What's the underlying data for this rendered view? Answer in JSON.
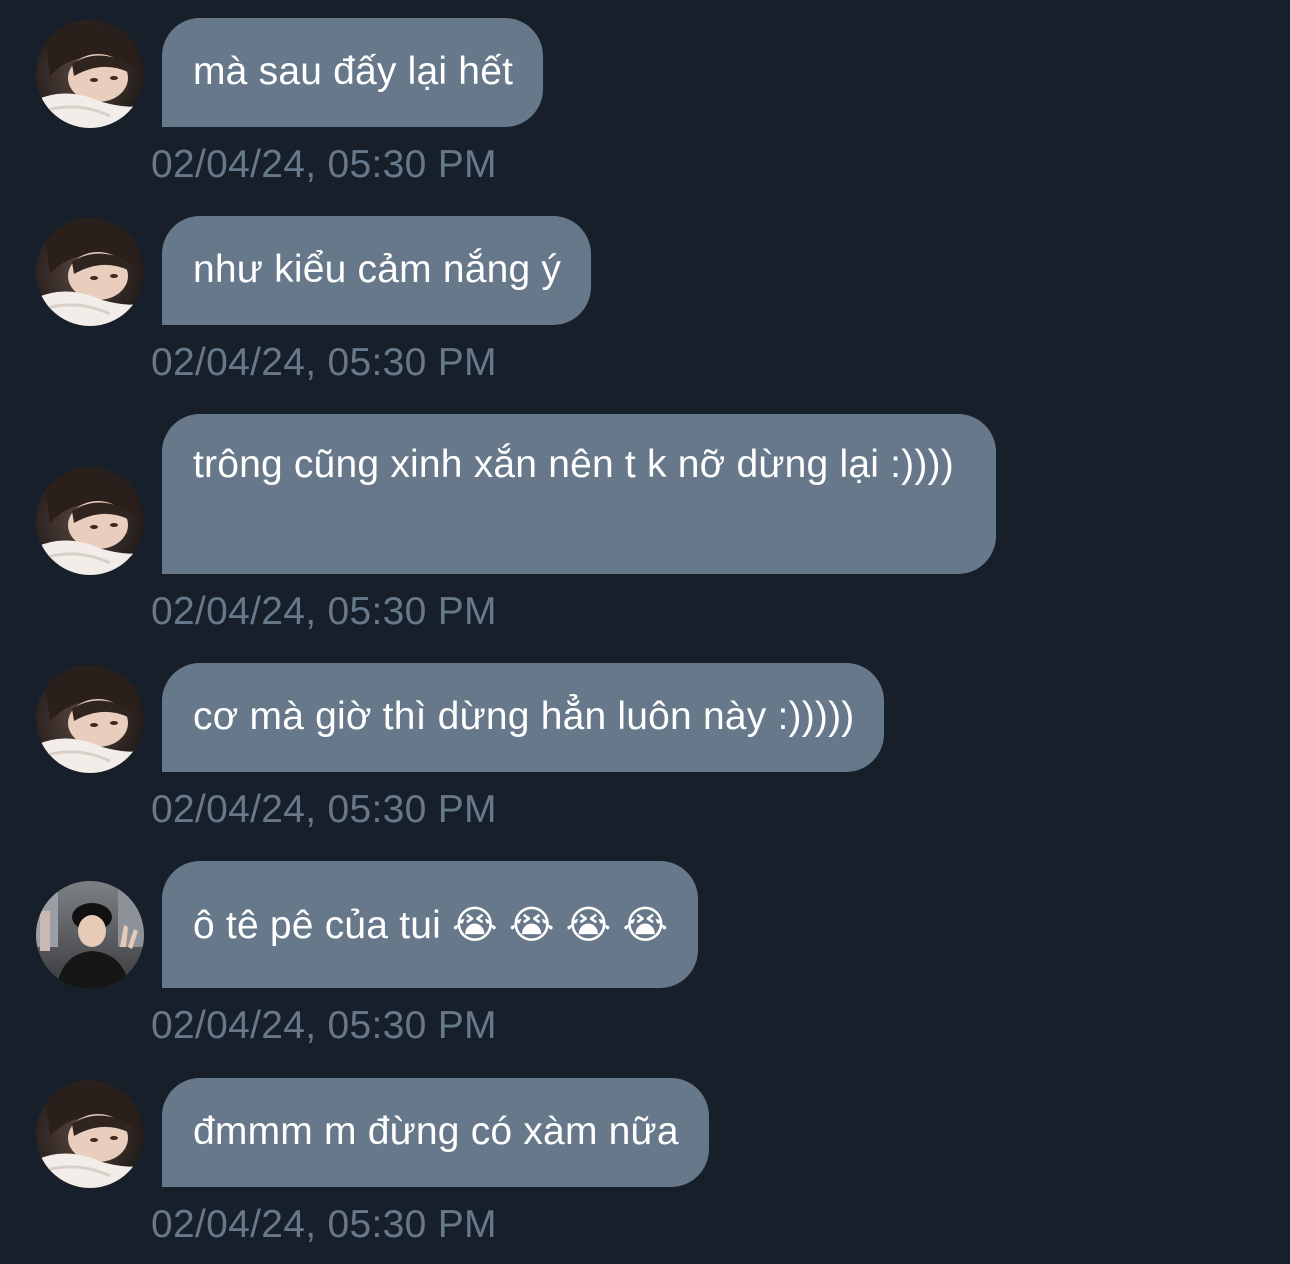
{
  "messages": [
    {
      "sender": "a",
      "text": "mà sau đấy lại hết",
      "time": "02/04/24, 05:30 PM"
    },
    {
      "sender": "a",
      "text": "như kiểu cảm nắng ý",
      "time": "02/04/24, 05:30 PM"
    },
    {
      "sender": "a",
      "text": "trông cũng xinh xắn nên t k nỡ dừng lại :))))",
      "time": "02/04/24, 05:30 PM"
    },
    {
      "sender": "a",
      "text": "cơ mà giờ thì dừng hẳn luôn này :)))))",
      "time": "02/04/24, 05:30 PM"
    },
    {
      "sender": "b",
      "text": "ô tê pê của tui 😭 😭 😭 😭",
      "time": "02/04/24, 05:30 PM"
    },
    {
      "sender": "a",
      "text": "đmmm m đừng có xàm nữa",
      "time": "02/04/24, 05:30 PM"
    }
  ],
  "colors": {
    "background": "#17202a",
    "bubble": "#66788a",
    "bubble_text": "#ffffff",
    "timestamp": "#66788a"
  }
}
